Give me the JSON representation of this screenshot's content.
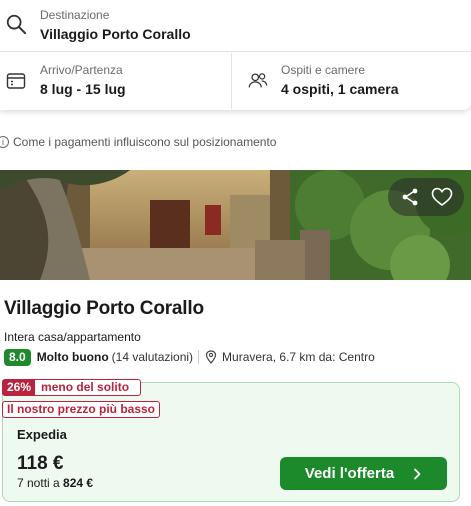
{
  "search": {
    "destination_label": "Destinazione",
    "destination_value": "Villaggio Porto Corallo",
    "dates_label": "Arrivo/Partenza",
    "dates_value": "8 lug - 15 lug",
    "guests_label": "Ospiti e camere",
    "guests_value": "4 ospiti, 1 camera"
  },
  "notice": {
    "text": "Come i pagamenti influiscono sul posizionamento",
    "icon": "info-icon"
  },
  "image": {
    "share_icon": "share-icon",
    "favorite_icon": "heart-icon"
  },
  "hotel": {
    "name": "Villaggio Porto Corallo",
    "type": "Intera casa/appartamento",
    "rating_score": "8.0",
    "rating_label": "Molto buono",
    "rating_count": "(14 valutazioni)",
    "location": "Muravera, 6.7 km da: Centro"
  },
  "deal": {
    "discount_pct": "26%",
    "discount_text": "meno del solito",
    "best_price_text": "Il nostro prezzo più basso",
    "provider": "Expedia",
    "price": "118 €",
    "nights_prefix": "7 notti a",
    "total": "824 €",
    "cta_label": "Vedi l'offerta"
  },
  "colors": {
    "accent_green": "#1c8a2a",
    "score_green": "#1f8a2c",
    "deal_red": "#b9233d",
    "deal_bg": "#eef9ef"
  }
}
